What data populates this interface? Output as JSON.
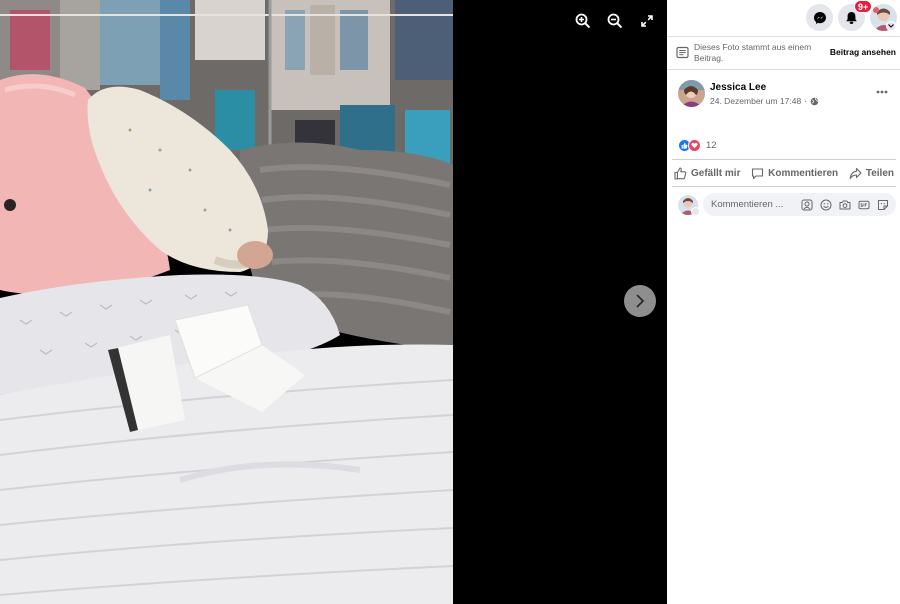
{
  "viewer": {
    "zoom_in_icon": "zoom-in-icon",
    "zoom_out_icon": "zoom-out-icon",
    "fullscreen_icon": "fullscreen-icon",
    "next_icon": "chevron-right-icon"
  },
  "header": {
    "messenger_icon": "messenger-icon",
    "notifications_icon": "bell-icon",
    "notifications_badge": "9+",
    "account_icon": "avatar"
  },
  "notice": {
    "text": "Dieses Foto stammt aus einem Beitrag.",
    "link": "Beitrag ansehen"
  },
  "post": {
    "author": "Jessica Lee",
    "date": "24. Dezember um 17:48",
    "separator": "·",
    "privacy_icon": "globe-icon",
    "reaction_count": "12",
    "reaction_icons": [
      "like-icon",
      "love-icon"
    ]
  },
  "actions": {
    "like": "Gefällt mir",
    "comment": "Kommentieren",
    "share": "Teilen"
  },
  "comment": {
    "placeholder": "Kommentieren ..."
  },
  "colors": {
    "accent_blue": "#1877f2",
    "badge_red": "#e41e3f",
    "love_red": "#f33e58",
    "text_secondary": "#65676b"
  }
}
